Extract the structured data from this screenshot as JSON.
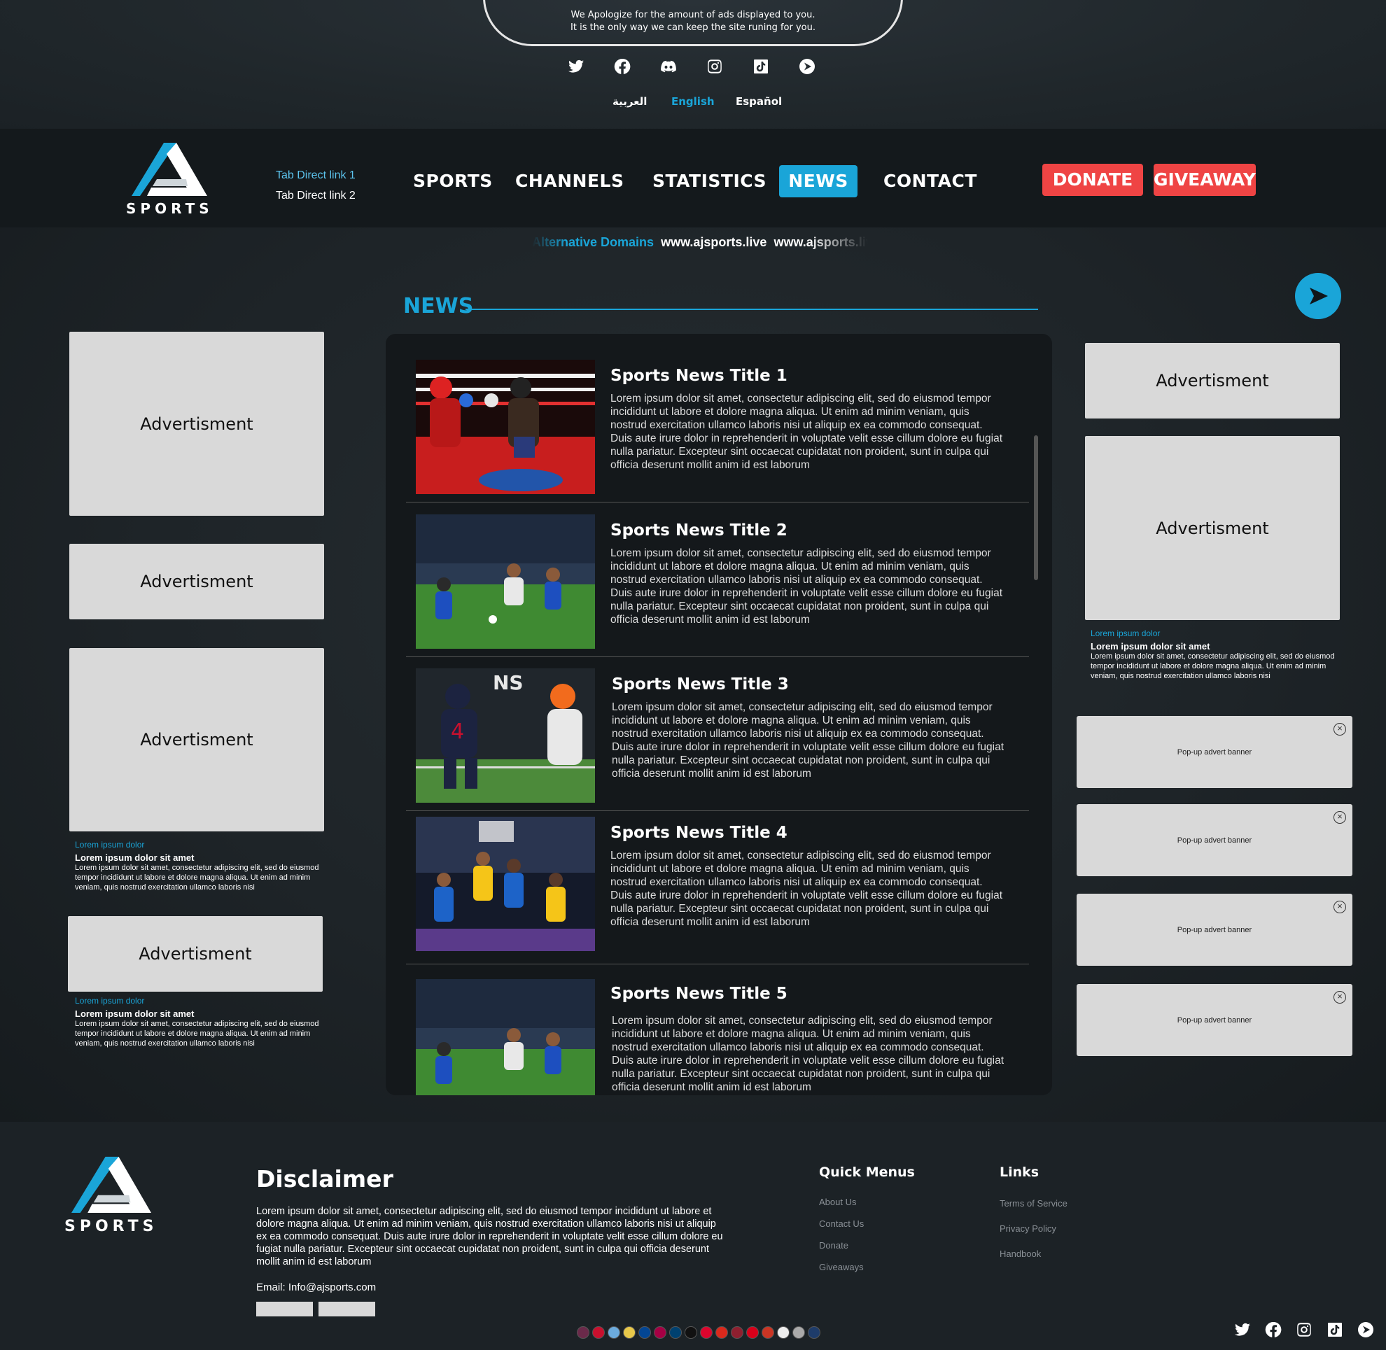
{
  "notice": {
    "line1": "We Apologize for the amount of ads displayed to you.",
    "line2": "It is the only way we can keep the site runing for you."
  },
  "social_icons": [
    "twitter-icon",
    "facebook-icon",
    "discord-icon",
    "instagram-icon",
    "tiktok-icon",
    "play-icon"
  ],
  "languages": [
    {
      "label": "العربية",
      "active": false
    },
    {
      "label": "English",
      "active": true
    },
    {
      "label": "Español",
      "active": false
    }
  ],
  "colors": {
    "accent": "#1aa5d8",
    "danger": "#ef4444",
    "ad_bg": "#d9d9d9",
    "bg": "#1c2226"
  },
  "header": {
    "logo_text": "SPORTS",
    "tab_links": [
      "Tab Direct link 1",
      "Tab Direct link 2"
    ],
    "nav": [
      "SPORTS",
      "CHANNELS",
      "STATISTICS",
      "NEWS",
      "CONTACT"
    ],
    "active_nav": "NEWS",
    "donate": "DONATE",
    "giveaway": "GIVEAWAY"
  },
  "alt_domains": {
    "label": "Alternative Domains",
    "domains": [
      "www.ajsports.live",
      "www.ajsports.live"
    ]
  },
  "news": {
    "heading": "NEWS",
    "items": [
      {
        "title": "Sports News Title 1",
        "body": "Lorem ipsum dolor sit amet, consectetur adipiscing elit, sed do eiusmod tempor incididunt ut labore et dolore magna aliqua. Ut enim ad minim veniam, quis nostrud exercitation ullamco laboris nisi ut aliquip ex ea commodo consequat. Duis aute irure dolor in reprehenderit in voluptate velit esse cillum dolore eu fugiat nulla pariatur. Excepteur sint occaecat cupidatat non proident, sunt in culpa qui officia deserunt mollit anim id est laborum",
        "image": "boxing"
      },
      {
        "title": "Sports News Title 2",
        "body": "Lorem ipsum dolor sit amet, consectetur adipiscing elit, sed do eiusmod tempor incididunt ut labore et dolore magna aliqua. Ut enim ad minim veniam, quis nostrud exercitation ullamco laboris nisi ut aliquip ex ea commodo consequat. Duis aute irure dolor in reprehenderit in voluptate velit esse cillum dolore eu fugiat nulla pariatur. Excepteur sint occaecat cupidatat non proident, sunt in culpa qui officia deserunt mollit anim id est laborum",
        "image": "soccer"
      },
      {
        "title": "Sports News Title 3",
        "body": "Lorem ipsum dolor sit amet, consectetur adipiscing elit, sed do eiusmod tempor incididunt ut labore et dolore magna aliqua. Ut enim ad minim veniam, quis nostrud exercitation ullamco laboris nisi ut aliquip ex ea commodo consequat. Duis aute irure dolor in reprehenderit in voluptate velit esse cillum dolore eu fugiat nulla pariatur. Excepteur sint occaecat cupidatat non proident, sunt in culpa qui officia deserunt mollit anim id est laborum",
        "image": "american-football"
      },
      {
        "title": "Sports News Title 4",
        "body": "Lorem ipsum dolor sit amet, consectetur adipiscing elit, sed do eiusmod tempor incididunt ut labore et dolore magna aliqua. Ut enim ad minim veniam, quis nostrud exercitation ullamco laboris nisi ut aliquip ex ea commodo consequat. Duis aute irure dolor in reprehenderit in voluptate velit esse cillum dolore eu fugiat nulla pariatur. Excepteur sint occaecat cupidatat non proident, sunt in culpa qui officia deserunt mollit anim id est laborum",
        "image": "basketball"
      },
      {
        "title": "Sports News Title 5",
        "body": "Lorem ipsum dolor sit amet, consectetur adipiscing elit, sed do eiusmod tempor incididunt ut labore et dolore magna aliqua. Ut enim ad minim veniam, quis nostrud exercitation ullamco laboris nisi ut aliquip ex ea commodo consequat. Duis aute irure dolor in reprehenderit in voluptate velit esse cillum dolore eu fugiat nulla pariatur. Excepteur sint occaecat cupidatat non proident, sunt in culpa qui officia deserunt mollit anim id est laborum",
        "image": "soccer"
      }
    ]
  },
  "ads": {
    "label": "Advertisment",
    "caption": {
      "kicker": "Lorem ipsum dolor",
      "title": "Lorem ipsum dolor sit amet",
      "text": "Lorem ipsum dolor sit amet, consectetur adipiscing elit, sed do eiusmod tempor incididunt ut labore et dolore magna aliqua. Ut enim ad minim veniam, quis nostrud exercitation ullamco laboris nisi"
    },
    "popup_label": "Pop-up advert banner"
  },
  "footer": {
    "logo_text": "SPORTS",
    "disclaimer_title": "Disclaimer",
    "disclaimer_body": "Lorem ipsum dolor sit amet, consectetur adipiscing elit, sed do eiusmod tempor incididunt ut labore et dolore magna aliqua. Ut enim ad minim veniam, quis nostrud exercitation ullamco laboris nisi ut aliquip ex ea commodo consequat. Duis aute irure dolor in reprehenderit in voluptate velit esse cillum dolore eu fugiat nulla pariatur. Excepteur sint occaecat cupidatat non proident, sunt in culpa qui officia deserunt mollit anim id est laborum",
    "email": "Email: Info@ajsports.com",
    "quick_menus_title": "Quick Menus",
    "quick_menus": [
      "About Us",
      "Contact Us",
      "Donate",
      "Giveaways"
    ],
    "links_title": "Links",
    "links": [
      "Terms of Service",
      "Privacy Policy",
      "Handbook"
    ]
  }
}
